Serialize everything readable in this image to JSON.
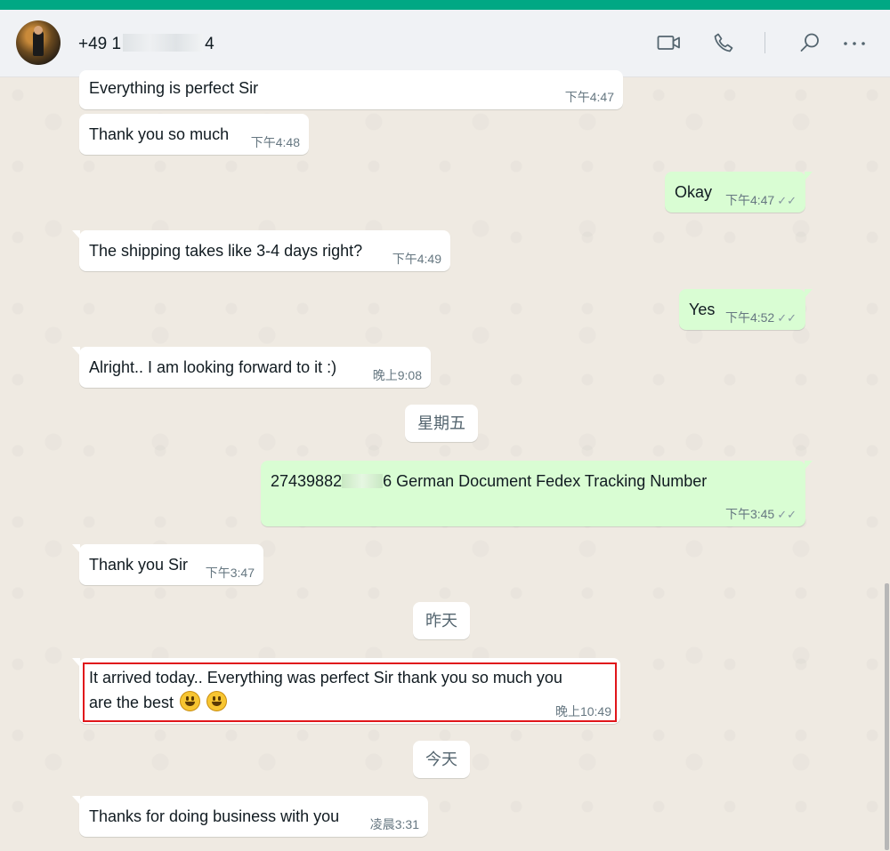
{
  "header": {
    "contact_prefix": "+49 1",
    "contact_suffix": "4",
    "icons": [
      "video-call-icon",
      "voice-call-icon",
      "search-icon",
      "more-options-icon"
    ]
  },
  "messages": [
    {
      "dir": "in",
      "text": "Everything is perfect Sir",
      "time": "下午4:47"
    },
    {
      "dir": "in",
      "text": "Thank you so much",
      "time": "下午4:48"
    },
    {
      "dir": "out",
      "text": "Okay",
      "time": "下午4:47"
    },
    {
      "dir": "in",
      "text": "The shipping takes like 3-4 days right?",
      "time": "下午4:49"
    },
    {
      "dir": "out",
      "text": "Yes",
      "time": "下午4:52"
    },
    {
      "dir": "in",
      "text": "Alright.. I am looking forward to it :)",
      "time": "晚上9:08"
    },
    {
      "dir": "out",
      "text_prefix": "27439882",
      "text_suffix": "6 German Document Fedex Tracking Number",
      "time": "下午3:45"
    },
    {
      "dir": "in",
      "text": "Thank you Sir",
      "time": "下午3:47"
    },
    {
      "dir": "in",
      "text_line1": "It arrived today.. Everything was perfect Sir thank you so much you",
      "text_line2": "are the best",
      "time": "晚上10:49"
    },
    {
      "dir": "in",
      "text": "Thanks for doing business with you",
      "time": "凌晨3:31"
    }
  ],
  "date_separators": [
    "星期五",
    "昨天",
    "今天"
  ],
  "colors": {
    "accent": "#00a884",
    "incoming_bubble": "#ffffff",
    "outgoing_bubble": "#d9fdd3",
    "chat_bg": "#efeae2",
    "highlight_border": "#e0161b"
  }
}
